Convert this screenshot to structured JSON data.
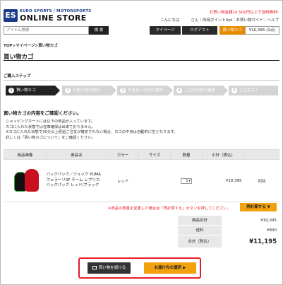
{
  "header": {
    "logo_mark": "ES",
    "logo_sub": "EURO SPORTS / MOTORSPORTS",
    "logo_main": "ONLINE STORE",
    "ship_note": "お買い物金額10,500円以上で送料無料!",
    "greeting": "こんにちは",
    "user_bar": "さん｜所持ポイント0pt｜お買い物ガイド｜ヘルプ",
    "search_placeholder": "アイテム検索",
    "search_button": "検 索",
    "mypage": "マイページ",
    "logout": "ログアウト",
    "cart_button": "買い物カゴ",
    "cart_total": "¥10,395 (1点)"
  },
  "breadcrumb": "TOP>マイページ>買い物カゴ",
  "page_title": "買い物カゴ",
  "steps_label": "ご購入ステップ",
  "steps": [
    {
      "num": "1",
      "label": "買い物カゴ"
    },
    {
      "num": "2",
      "label": "お届け先の選択"
    },
    {
      "num": "3",
      "label": "お支払い方法の選択"
    },
    {
      "num": "4",
      "label": "ご注文内容の確認"
    },
    {
      "num": "5",
      "label": "ご注文完了"
    }
  ],
  "confirm_title": "買い物カゴの内容をご確認ください。",
  "notes": [
    "ショッピングカートには以下の商品が入っています。",
    "カゴに入れた状態では在庫確保は出来ておりません。",
    "※カゴに入れた状態で30分以上経過ご注文が確定されない場合、カゴの中身は自動的に空となります。",
    "詳しくは「買い物カゴについて」をご確認ください。"
  ],
  "table": {
    "headers": [
      "商品画像",
      "商品名",
      "カラー",
      "サイズ",
      "数量",
      "小計（税込）",
      ""
    ],
    "item": {
      "name": "バックパック／ジュック PUMA フェラーリSF チーム レプリカバックパック レッド/ブラック",
      "color": "レッド",
      "size": "",
      "qty": "1",
      "subtotal": "¥10,395",
      "delete": "削除"
    }
  },
  "recalc_note": "※商品の数量を変更した場合は「再計算する」ボタンを押してください。",
  "recalc_button": "再計算する ▼",
  "summary": {
    "subtotal_label": "商品合計",
    "subtotal_value": "¥10,395",
    "shipping_label": "送料",
    "shipping_value": "¥800",
    "total_label": "合計（税込）",
    "total_value": "¥11,195"
  },
  "actions": {
    "continue": "買い物を続ける",
    "checkout": "お届け先の選択 ▶"
  },
  "colors": {
    "accent": "#f2a20c",
    "brand": "#1b3b8a",
    "alert": "#e61e2a"
  }
}
